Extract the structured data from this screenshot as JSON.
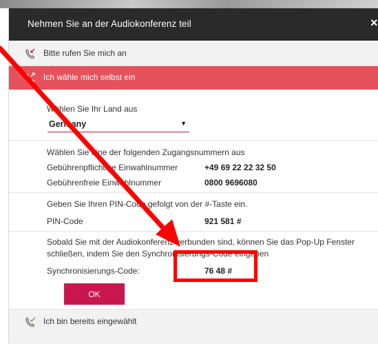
{
  "dialog": {
    "title": "Nehmen Sie an der Audiokonferenz teil",
    "close_label": "×"
  },
  "options": {
    "call_me": "Bitte rufen Sie mich an",
    "dial_in": "Ich wähle mich selbst ein",
    "already_dialed": "Ich bin bereits eingewählt"
  },
  "country": {
    "label": "Wählen Sie Ihr Land aus",
    "selected": "Germany"
  },
  "access": {
    "intro": "Wählen Sie eine der folgenden Zugangsnummern aus",
    "toll_label": "Gebührenpflichtige Einwahlnummer",
    "toll_number": "+49 69 22 22 32 50",
    "tollfree_label": "Gebührenfreie Einwahlnummer",
    "tollfree_number": "0800 9696080"
  },
  "pin": {
    "instruction": "Geben Sie Ihren PIN-Code gefolgt von der #-Taste ein.",
    "label": "PIN-Code",
    "value": "921 581 #"
  },
  "sync": {
    "instruction_line1": "Sobald Sie mit der Audiokonferenz verbunden sind, können Sie das Pop-Up Fenster",
    "instruction_line2": "schließen, indem Sie den Synchronisierungs-Code eingeben",
    "label": "Synchronisierungs-Code:",
    "value": "76 48 #"
  },
  "ok_button": "OK",
  "colors": {
    "titlebar": "#2a2a2a",
    "active_option": "#e5525b",
    "ok_button": "#c8174f",
    "annotation": "#ff0000"
  }
}
